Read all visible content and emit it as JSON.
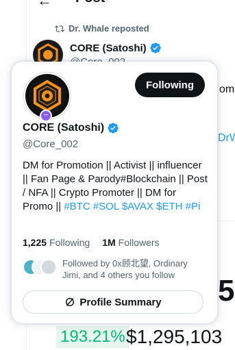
{
  "background": {
    "page_title": "Post",
    "back_icon": "arrow-left-icon",
    "repost_text": "Dr. Whale reposted",
    "author_name": "CORE (Satoshi)",
    "author_handle": "@Core_002",
    "partial_text_right": "om",
    "partial_link_right": "DrW",
    "big_number_partial": "5",
    "percent_change": "193.21%",
    "price": "$1,295,103"
  },
  "hovercard": {
    "name": "CORE (Satoshi)",
    "handle": "@Core_002",
    "follow_button_label": "Following",
    "bio_text": "DM for Promotion || Activist || influencer || Fan Page & Parody#Blockchain || Post / NFA  || Crypto Promoter || DM for Promo ||",
    "bio_tags": [
      "#BTC",
      "#SOL",
      "$AVAX",
      "$ETH",
      "#Pi"
    ],
    "following_count": "1,225",
    "following_label": "Following",
    "followers_count": "1M",
    "followers_label": "Followers",
    "followed_by_text": "Followed by 0x顾北望, Ordinary Jimi, and 4 others you follow",
    "profile_summary_label": "Profile Summary"
  },
  "colors": {
    "accent": "#1d9bf0",
    "verified": "#1d9bf0",
    "button_dark": "#0f1419",
    "muted_text": "#536471",
    "positive": "#00ba7c"
  }
}
